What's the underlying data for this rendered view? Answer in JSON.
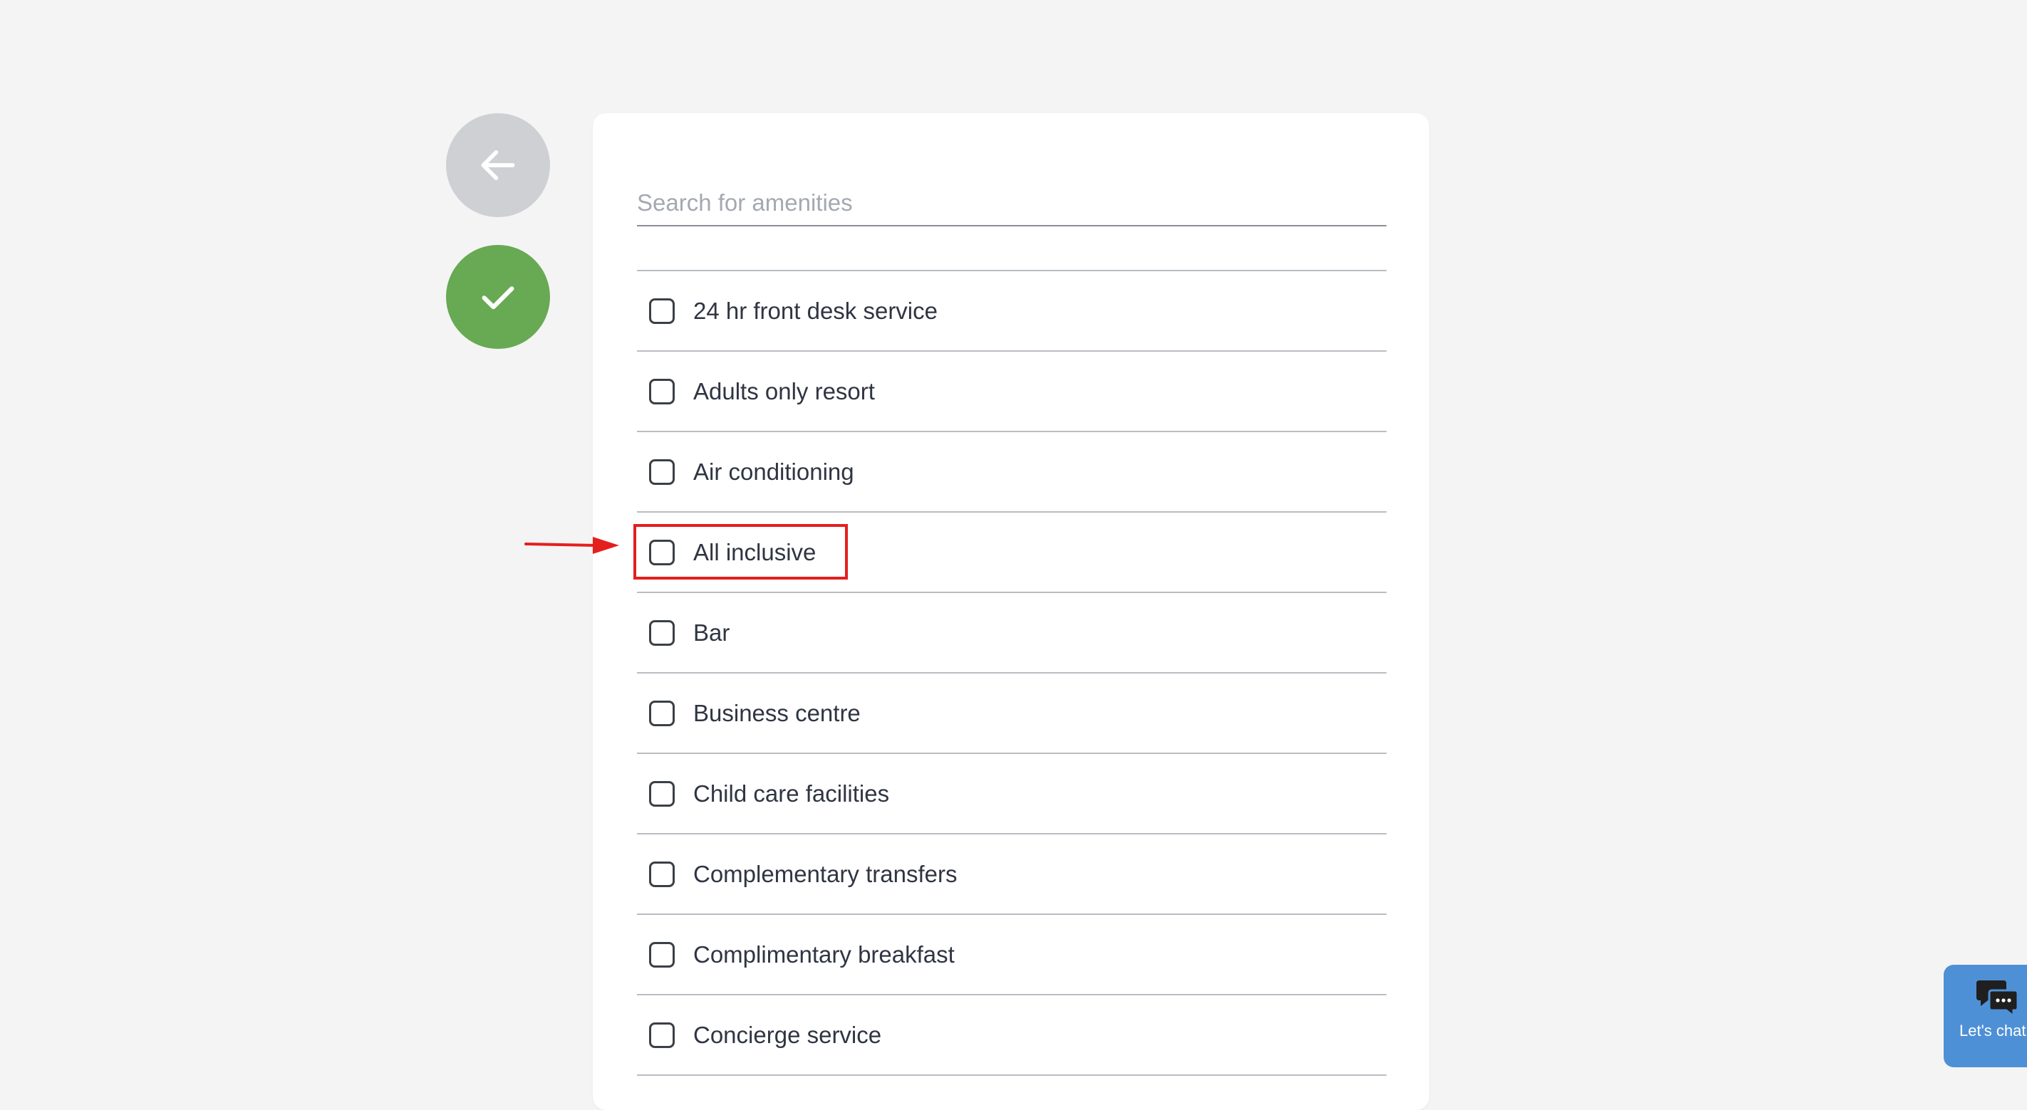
{
  "search": {
    "placeholder": "Search for amenities",
    "value": ""
  },
  "amenities": [
    {
      "label": "24 hr front desk service",
      "checked": false
    },
    {
      "label": "Adults only resort",
      "checked": false
    },
    {
      "label": "Air conditioning",
      "checked": false
    },
    {
      "label": "All inclusive",
      "checked": false
    },
    {
      "label": "Bar",
      "checked": false
    },
    {
      "label": "Business centre",
      "checked": false
    },
    {
      "label": "Child care facilities",
      "checked": false
    },
    {
      "label": "Complementary transfers",
      "checked": false
    },
    {
      "label": "Complimentary breakfast",
      "checked": false
    },
    {
      "label": "Concierge service",
      "checked": false
    }
  ],
  "chat": {
    "label": "Let's chat"
  },
  "icons": {
    "back": "arrow-left-icon",
    "confirm": "checkmark-icon",
    "chat": "chat-bubbles-icon"
  },
  "colors": {
    "back_button": "#cfd0d3",
    "confirm_button": "#68a953",
    "highlight": "#e51e1e",
    "chat_widget": "#4e90d6"
  }
}
